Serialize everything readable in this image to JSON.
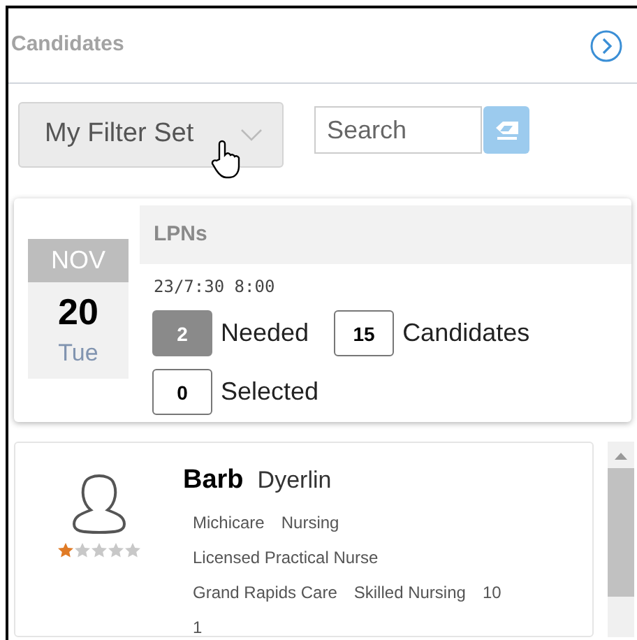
{
  "panel": {
    "title": "Candidates"
  },
  "filter": {
    "value": "My Filter Set"
  },
  "search": {
    "placeholder": "Search"
  },
  "shift": {
    "month": "NOV",
    "day": "20",
    "weekday": "Tue",
    "title": "LPNs",
    "time": "23/7:30 8:00",
    "counts": [
      {
        "kind": "filled",
        "value": "2",
        "label": "Needed"
      },
      {
        "kind": "outline",
        "value": "15",
        "label": "Candidates"
      },
      {
        "kind": "outline",
        "value": "0",
        "label": "Selected"
      }
    ]
  },
  "candidate": {
    "first_name": "Barb",
    "last_name": "Dyerlin",
    "stars": 1,
    "lines": [
      [
        "Michicare",
        "Nursing"
      ],
      [
        "Licensed Practical Nurse"
      ],
      [
        "Grand Rapids Care",
        "Skilled Nursing",
        "10"
      ],
      [
        "1"
      ]
    ]
  }
}
